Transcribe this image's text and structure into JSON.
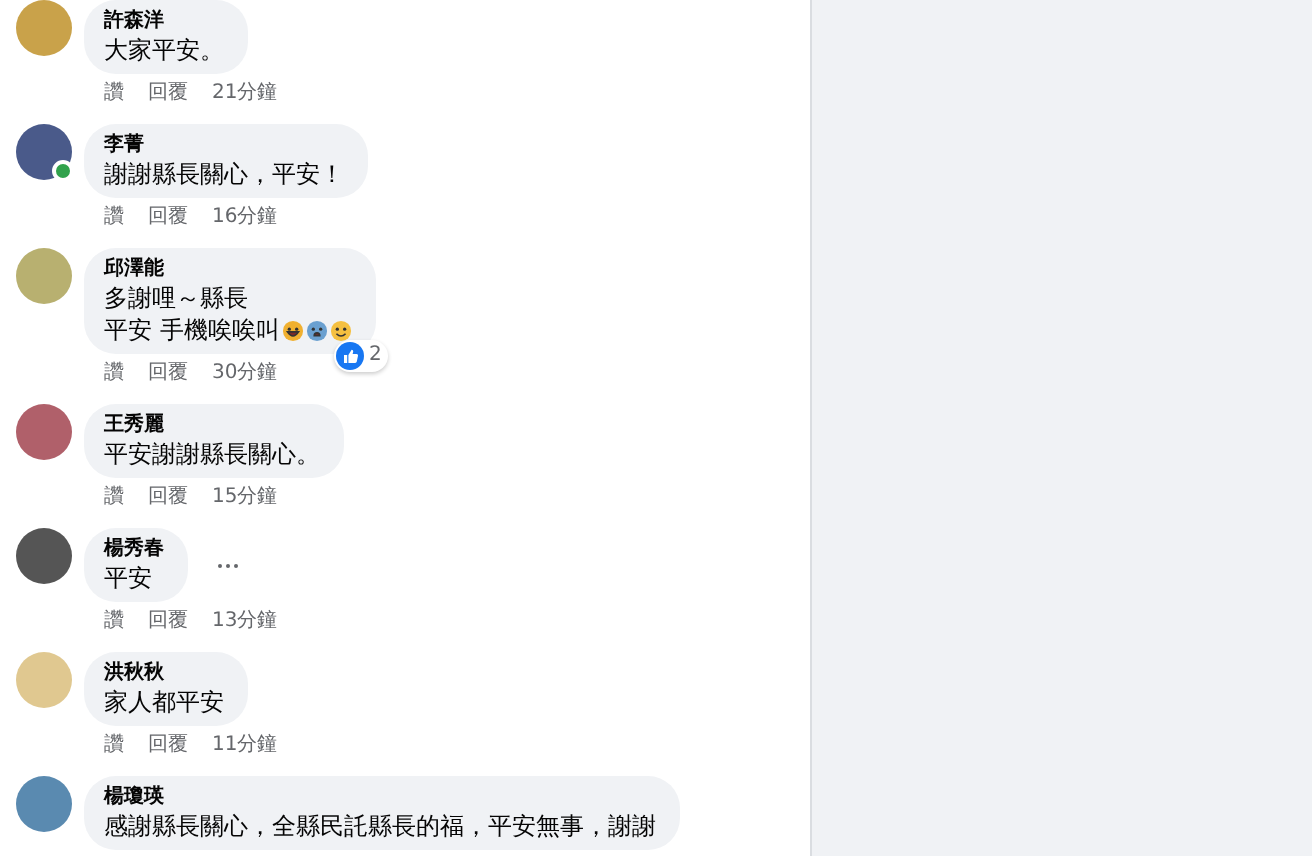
{
  "comments": [
    {
      "name": "許森洋",
      "lines": [
        "大家平安。"
      ],
      "online": false,
      "more": false,
      "actions": {
        "like": "讚",
        "reply": "回覆",
        "time": "21分鐘"
      }
    },
    {
      "name": "李菁",
      "lines": [
        "謝謝縣長關心，平安！"
      ],
      "online": true,
      "more": false,
      "actions": {
        "like": "讚",
        "reply": "回覆",
        "time": "16分鐘"
      }
    },
    {
      "name": "邱澤能",
      "lines": [
        "多謝哩～縣長",
        "平安 手機唉唉叫"
      ],
      "online": false,
      "emojis": [
        {
          "kind": "laughing"
        },
        {
          "kind": "fearful"
        },
        {
          "kind": "smiling"
        }
      ],
      "reactions": "2",
      "more": false,
      "actions": {
        "like": "讚",
        "reply": "回覆",
        "time": "30分鐘"
      }
    },
    {
      "name": "王秀麗",
      "lines": [
        "平安謝謝縣長關心。"
      ],
      "online": false,
      "more": false,
      "actions": {
        "like": "讚",
        "reply": "回覆",
        "time": "15分鐘"
      }
    },
    {
      "name": "楊秀春",
      "lines": [
        "平安"
      ],
      "online": false,
      "more": true,
      "actions": {
        "like": "讚",
        "reply": "回覆",
        "time": "13分鐘"
      }
    },
    {
      "name": "洪秋秋",
      "lines": [
        "家人都平安"
      ],
      "online": false,
      "more": false,
      "actions": {
        "like": "讚",
        "reply": "回覆",
        "time": "11分鐘"
      }
    },
    {
      "name": "楊瓊瑛",
      "lines": [
        "感謝縣長關心，全縣民託縣長的福，平安無事，謝謝"
      ],
      "online": false,
      "more": false
    }
  ]
}
